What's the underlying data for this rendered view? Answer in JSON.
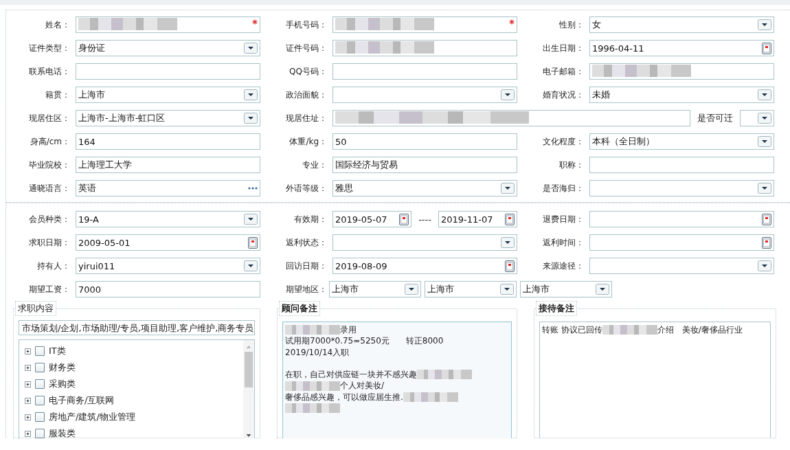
{
  "sections": [
    {
      "rows": [
        {
          "groups": [
            {
              "label": "姓名：",
              "kind": "standard",
              "controls": [
                {
                  "kind": "text",
                  "required": true,
                  "redacted": true
                }
              ]
            },
            {
              "label": "手机号码：",
              "kind": "standard",
              "controls": [
                {
                  "kind": "text",
                  "required": true,
                  "redacted": true
                }
              ]
            },
            {
              "label": "性别：",
              "kind": "standard",
              "controls": [
                {
                  "kind": "select",
                  "value": "女",
                  "required": false,
                  "redacted": false
                }
              ]
            }
          ]
        },
        {
          "groups": [
            {
              "label": "证件类型：",
              "kind": "standard",
              "controls": [
                {
                  "kind": "select",
                  "value": "身份证",
                  "required": false,
                  "redacted": false
                }
              ]
            },
            {
              "label": "证件号码：",
              "kind": "standard",
              "controls": [
                {
                  "kind": "text",
                  "required": false,
                  "redacted": true
                }
              ]
            },
            {
              "label": "出生日期：",
              "kind": "standard",
              "controls": [
                {
                  "kind": "date",
                  "value": "1996-04-11",
                  "required": false,
                  "redacted": false
                }
              ]
            }
          ]
        },
        {
          "groups": [
            {
              "label": "联系电话：",
              "kind": "standard",
              "controls": [
                {
                  "kind": "text",
                  "required": false,
                  "redacted": false
                }
              ]
            },
            {
              "label": "QQ号码：",
              "kind": "standard",
              "controls": [
                {
                  "kind": "text",
                  "required": false,
                  "redacted": false
                }
              ]
            },
            {
              "label": "电子邮箱：",
              "kind": "standard",
              "controls": [
                {
                  "kind": "text",
                  "required": false,
                  "redacted": true
                }
              ]
            }
          ]
        },
        {
          "groups": [
            {
              "label": "籍贯：",
              "kind": "standard",
              "controls": [
                {
                  "kind": "select",
                  "value": "上海市",
                  "required": false,
                  "redacted": false
                }
              ]
            },
            {
              "label": "政治面貌：",
              "kind": "standard",
              "controls": [
                {
                  "kind": "select",
                  "required": false,
                  "redacted": false
                }
              ]
            },
            {
              "label": "婚育状况：",
              "kind": "standard",
              "controls": [
                {
                  "kind": "select",
                  "value": "未婚",
                  "required": false,
                  "redacted": false
                }
              ]
            }
          ]
        },
        {
          "groups": [
            {
              "label": "现居住区：",
              "kind": "standard",
              "controls": [
                {
                  "kind": "select",
                  "value": "上海市-上海市-虹口区",
                  "required": false,
                  "redacted": false
                }
              ]
            },
            {
              "label": "现居住址：",
              "kind": "wide",
              "controls": [
                {
                  "kind": "text",
                  "required": false,
                  "redacted": true
                },
                {
                  "kind": "label",
                  "value": "是否可迁"
                },
                {
                  "kind": "select",
                  "required": false,
                  "redacted": false
                }
              ]
            }
          ]
        },
        {
          "groups": [
            {
              "label": "身高/cm：",
              "kind": "standard",
              "controls": [
                {
                  "kind": "text",
                  "value": "164",
                  "required": false,
                  "redacted": false
                }
              ]
            },
            {
              "label": "体重/kg：",
              "kind": "standard",
              "controls": [
                {
                  "kind": "text",
                  "value": "50",
                  "required": false,
                  "redacted": false
                }
              ]
            },
            {
              "label": "文化程度：",
              "kind": "standard",
              "controls": [
                {
                  "kind": "select",
                  "value": "本科（全日制）",
                  "required": false,
                  "redacted": false
                }
              ]
            }
          ]
        },
        {
          "groups": [
            {
              "label": "毕业院校：",
              "kind": "standard",
              "controls": [
                {
                  "kind": "text",
                  "value": "上海理工大学",
                  "required": false,
                  "redacted": false
                }
              ]
            },
            {
              "label": "专业：",
              "kind": "standard",
              "controls": [
                {
                  "kind": "text",
                  "value": "国际经济与贸易",
                  "required": false,
                  "redacted": false
                }
              ]
            },
            {
              "label": "职称：",
              "kind": "standard",
              "controls": [
                {
                  "kind": "text",
                  "required": false,
                  "redacted": false
                }
              ]
            }
          ]
        },
        {
          "groups": [
            {
              "label": "通晓语言：",
              "kind": "standard",
              "controls": [
                {
                  "kind": "lookup",
                  "value": "英语",
                  "required": false,
                  "redacted": false
                }
              ]
            },
            {
              "label": "外语等级：",
              "kind": "standard",
              "controls": [
                {
                  "kind": "select",
                  "value": "雅思",
                  "required": false,
                  "redacted": false
                }
              ]
            },
            {
              "label": "是否海归：",
              "kind": "standard",
              "controls": [
                {
                  "kind": "select",
                  "required": false,
                  "redacted": false
                }
              ]
            }
          ]
        }
      ]
    },
    {
      "rows": [
        {
          "groups": [
            {
              "label": "会员种类：",
              "kind": "standard",
              "controls": [
                {
                  "kind": "select",
                  "value": "19-A",
                  "required": false,
                  "redacted": false
                }
              ]
            },
            {
              "label": "有效期：",
              "kind": "standard",
              "controls": [
                {
                  "kind": "date",
                  "value": "2019-05-07",
                  "required": false,
                  "redacted": false
                },
                {
                  "kind": "label",
                  "value": "----"
                },
                {
                  "kind": "date",
                  "value": "2019-11-07",
                  "required": false,
                  "redacted": false
                }
              ]
            },
            {
              "label": "退费日期：",
              "kind": "standard",
              "controls": [
                {
                  "kind": "date",
                  "required": false,
                  "redacted": false
                }
              ]
            }
          ]
        },
        {
          "groups": [
            {
              "label": "求职日期：",
              "kind": "standard",
              "controls": [
                {
                  "kind": "date",
                  "value": "2009-05-01",
                  "required": false,
                  "redacted": false
                }
              ]
            },
            {
              "label": "返利状态：",
              "kind": "standard",
              "controls": [
                {
                  "kind": "select",
                  "required": false,
                  "redacted": false
                }
              ]
            },
            {
              "label": "返利时间：",
              "kind": "standard",
              "controls": [
                {
                  "kind": "date",
                  "required": false,
                  "redacted": false
                }
              ]
            }
          ]
        },
        {
          "groups": [
            {
              "label": "持有人：",
              "kind": "standard",
              "controls": [
                {
                  "kind": "select",
                  "value": "yirui011",
                  "required": false,
                  "redacted": false
                }
              ]
            },
            {
              "label": "回访日期：",
              "kind": "standard",
              "controls": [
                {
                  "kind": "date",
                  "value": "2019-08-09",
                  "required": false,
                  "redacted": false
                }
              ]
            },
            {
              "label": "来源途径：",
              "kind": "standard",
              "controls": [
                {
                  "kind": "select",
                  "required": false,
                  "redacted": false
                }
              ]
            }
          ]
        },
        {
          "groups": [
            {
              "label": "期望工资：",
              "kind": "standard",
              "controls": [
                {
                  "kind": "text",
                  "value": "7000",
                  "required": false,
                  "redacted": false
                }
              ]
            },
            {
              "label": "期望地区：",
              "kind": "triple",
              "controls": [
                {
                  "kind": "select",
                  "value": "上海市",
                  "required": false,
                  "redacted": false
                },
                {
                  "kind": "select",
                  "value": "上海市",
                  "required": false,
                  "redacted": false
                },
                {
                  "kind": "select",
                  "value": "上海市",
                  "required": false,
                  "redacted": false
                }
              ]
            }
          ]
        }
      ]
    }
  ],
  "panels": [
    {
      "kind": "tree",
      "title": "求职内容",
      "summary": "市场策划/企划,市场助理/专员,项目助理,客户维护,商务专员",
      "items": [
        {
          "label": "IT类",
          "checked": false,
          "expanded": false
        },
        {
          "label": "财务类",
          "checked": false,
          "expanded": false
        },
        {
          "label": "采购类",
          "checked": false,
          "expanded": false
        },
        {
          "label": "电子商务/互联网",
          "checked": false,
          "expanded": false
        },
        {
          "label": "房地产/建筑/物业管理",
          "checked": false,
          "expanded": false
        },
        {
          "label": "服装类",
          "checked": false,
          "expanded": false
        }
      ]
    },
    {
      "kind": "notes",
      "title": "顾问备注",
      "shaded": true,
      "lines": [
        {
          "kind": "line",
          "segments": [
            {
              "kind": "redacted"
            },
            {
              "kind": "text",
              "text": "录用"
            }
          ]
        },
        {
          "kind": "line",
          "segments": [
            {
              "kind": "text",
              "text": "试用期7000*0.75=5250元　　转正8000"
            }
          ]
        },
        {
          "kind": "line",
          "segments": [
            {
              "kind": "text",
              "text": "2019/10/14入职"
            }
          ]
        },
        {
          "kind": "blank"
        },
        {
          "kind": "line",
          "segments": [
            {
              "kind": "text",
              "text": "在职，自己对供应链一块并不感兴趣"
            },
            {
              "kind": "redacted"
            }
          ]
        },
        {
          "kind": "line",
          "segments": [
            {
              "kind": "redacted"
            },
            {
              "kind": "text",
              "text": "个人对美妆/"
            }
          ]
        },
        {
          "kind": "line",
          "segments": [
            {
              "kind": "text",
              "text": "奢侈品感兴趣，可以做应届生推."
            },
            {
              "kind": "redacted"
            }
          ]
        },
        {
          "kind": "line",
          "segments": [
            {
              "kind": "redacted"
            }
          ]
        }
      ]
    },
    {
      "kind": "notes",
      "title": "接待备注",
      "shaded": false,
      "lines": [
        {
          "kind": "line",
          "segments": [
            {
              "kind": "text",
              "text": "转账  协议已回传"
            },
            {
              "kind": "redacted"
            },
            {
              "kind": "text",
              "text": "介绍　美妆/奢侈品行业"
            }
          ]
        }
      ]
    }
  ]
}
